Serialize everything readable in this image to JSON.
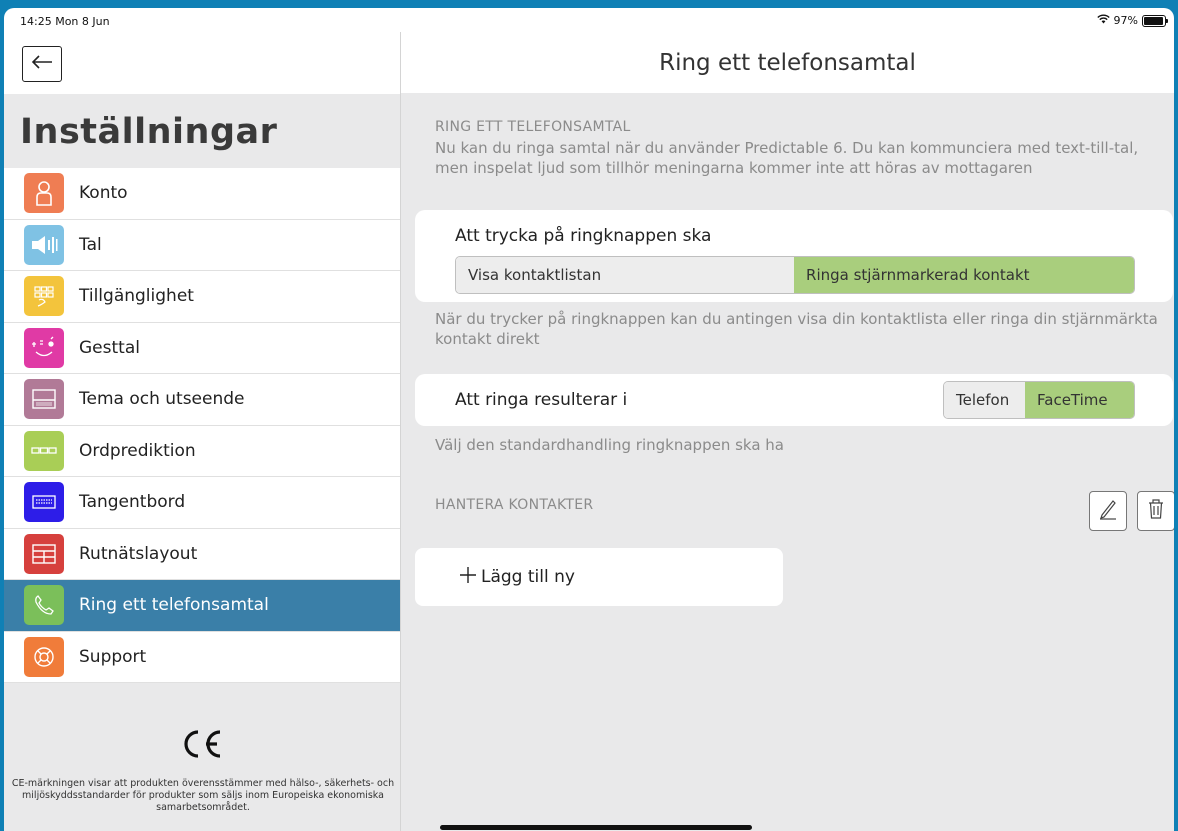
{
  "status": {
    "time": "14:25  Mon 8 Jun",
    "battery": "97%"
  },
  "sidebar": {
    "title": "Inställningar",
    "items": [
      {
        "label": "Konto",
        "icon": "person-icon",
        "color": "#ef7d53"
      },
      {
        "label": "Tal",
        "icon": "speaker-icon",
        "color": "#7fc2e4"
      },
      {
        "label": "Tillgänglighet",
        "icon": "accessibility-grid-icon",
        "color": "#f3c43c"
      },
      {
        "label": "Gesttal",
        "icon": "gesture-face-icon",
        "color": "#e03aa5"
      },
      {
        "label": "Tema och utseende",
        "icon": "theme-screen-icon",
        "color": "#b17a97"
      },
      {
        "label": "Ordprediktion",
        "icon": "word-prediction-icon",
        "color": "#a9ce56"
      },
      {
        "label": "Tangentbord",
        "icon": "keyboard-icon",
        "color": "#2d1de8"
      },
      {
        "label": "Rutnätslayout",
        "icon": "grid-layout-icon",
        "color": "#d6403d"
      },
      {
        "label": "Ring ett telefonsamtal",
        "icon": "phone-icon",
        "color": "#7bbf5a",
        "active": true
      },
      {
        "label": "Support",
        "icon": "lifebuoy-icon",
        "color": "#f07c3a"
      }
    ],
    "ce_mark": "CE",
    "ce_text": "CE-märkningen visar att produkten överensstämmer med hälso-, säkerhets- och miljöskyddsstandarder för produkter som säljs inom Europeiska ekonomiska samarbetsområdet."
  },
  "main": {
    "title": "Ring ett telefonsamtal",
    "section1": {
      "heading": "RING ETT TELEFONSAMTAL",
      "description": "Nu kan du ringa samtal när du använder Predictable 6. Du kan kommunciera med text-till-tal, men inspelat ljud som tillhör meningarna kommer inte att höras av mottagaren"
    },
    "call_button": {
      "title": "Att trycka på ringknappen ska",
      "options": [
        "Visa kontaktlistan",
        "Ringa stjärnmarkerad kontakt"
      ],
      "selected": 1,
      "hint": "När du trycker på ringknappen kan du antingen visa din kontaktlista eller ringa din stjärnmärkta kontakt direkt"
    },
    "call_result": {
      "title": "Att ringa resulterar i",
      "options": [
        "Telefon",
        "FaceTime"
      ],
      "selected": 1,
      "hint": "Välj den standardhandling ringknappen ska ha"
    },
    "contacts": {
      "heading": "HANTERA KONTAKTER",
      "add_label": "Lägg till ny",
      "add_icon": "plus-icon",
      "edit_icon": "pencil-icon",
      "delete_icon": "trash-icon"
    },
    "accent_selected": "#a9ce7d",
    "accent_active": "#3a7fa8"
  }
}
